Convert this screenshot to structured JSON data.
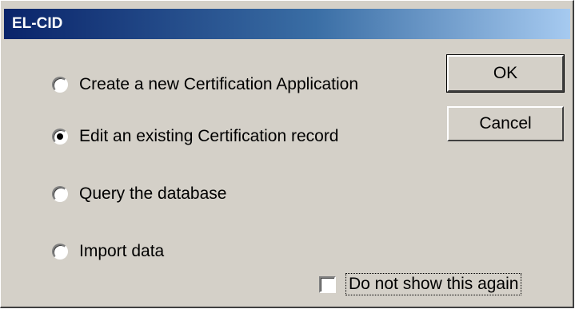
{
  "window": {
    "title": "EL-CID"
  },
  "options": [
    {
      "label": "Create a new Certification Application",
      "checked": false
    },
    {
      "label": "Edit an existing Certification record",
      "checked": true
    },
    {
      "label": "Query the database",
      "checked": false
    },
    {
      "label": "Import data",
      "checked": false
    }
  ],
  "buttons": {
    "ok_label": "OK",
    "cancel_label": "Cancel"
  },
  "checkbox": {
    "label": "Do not show this again",
    "checked": false
  },
  "colors": {
    "title_start": "#0a246a",
    "title_end": "#a6caf0",
    "face": "#d4d0c8"
  }
}
